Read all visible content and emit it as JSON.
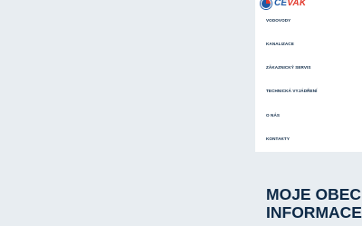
{
  "logo": {
    "prefix": "ČE",
    "suffix": "VAK"
  },
  "menu": {
    "items": [
      {
        "label": "VODOVODY"
      },
      {
        "label": "KANALIZACE"
      },
      {
        "label": "ZÁKAZNICKÝ SERVIS"
      },
      {
        "label": "TECHNICKÁ VYJÁDŘENÍ"
      },
      {
        "label": "O NÁS"
      },
      {
        "label": "KONTAKTY"
      }
    ]
  },
  "hero": {
    "line1": "MOJE OBEC",
    "line2": "INFORMACE"
  },
  "colors": {
    "brand_blue": "#1f5aa6",
    "brand_red": "#e23a2e",
    "navy": "#0e2a47",
    "page_bg": "#e8edf1"
  }
}
